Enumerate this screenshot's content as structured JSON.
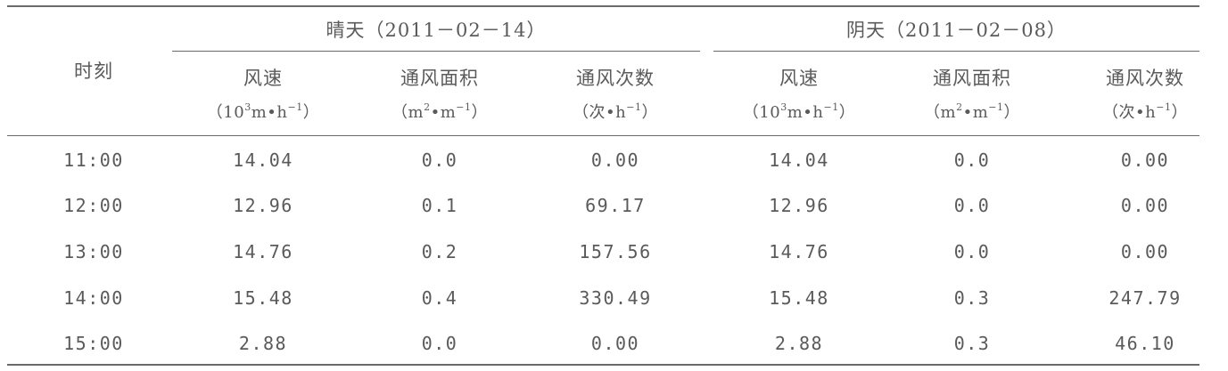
{
  "table": {
    "time_header": "时刻",
    "groups": [
      {
        "label": "晴天（2011－02－14）"
      },
      {
        "label": "阴天（2011－02－08）"
      }
    ],
    "columns": [
      {
        "name": "风速",
        "unit_pre": "（10",
        "unit_sup1": "3",
        "unit_mid": "m•h",
        "unit_sup2": "−1",
        "unit_post": "）"
      },
      {
        "name": "通风面积",
        "unit_pre": "（m",
        "unit_sup1": "2",
        "unit_mid": "•m",
        "unit_sup2": "−1",
        "unit_post": "）"
      },
      {
        "name": "通风次数",
        "unit_pre": "（次•h",
        "unit_sup1": "",
        "unit_mid": "",
        "unit_sup2": "−1",
        "unit_post": "）"
      },
      {
        "name": "风速",
        "unit_pre": "（10",
        "unit_sup1": "3",
        "unit_mid": "m•h",
        "unit_sup2": "−1",
        "unit_post": "）"
      },
      {
        "name": "通风面积",
        "unit_pre": "（m",
        "unit_sup1": "2",
        "unit_mid": "•m",
        "unit_sup2": "−1",
        "unit_post": "）"
      },
      {
        "name": "通风次数",
        "unit_pre": "（次•h",
        "unit_sup1": "",
        "unit_mid": "",
        "unit_sup2": "−1",
        "unit_post": "）"
      }
    ],
    "rows": [
      {
        "time": "11:00",
        "values": [
          "14.04",
          "0.0",
          "0.00",
          "14.04",
          "0.0",
          "0.00"
        ]
      },
      {
        "time": "12:00",
        "values": [
          "12.96",
          "0.1",
          "69.17",
          "12.96",
          "0.0",
          "0.00"
        ]
      },
      {
        "time": "13:00",
        "values": [
          "14.76",
          "0.2",
          "157.56",
          "14.76",
          "0.0",
          "0.00"
        ]
      },
      {
        "time": "14:00",
        "values": [
          "15.48",
          "0.4",
          "330.49",
          "15.48",
          "0.3",
          "247.79"
        ]
      },
      {
        "time": "15:00",
        "values": [
          "2.88",
          "0.0",
          "0.00",
          "2.88",
          "0.3",
          "46.10"
        ]
      }
    ]
  }
}
